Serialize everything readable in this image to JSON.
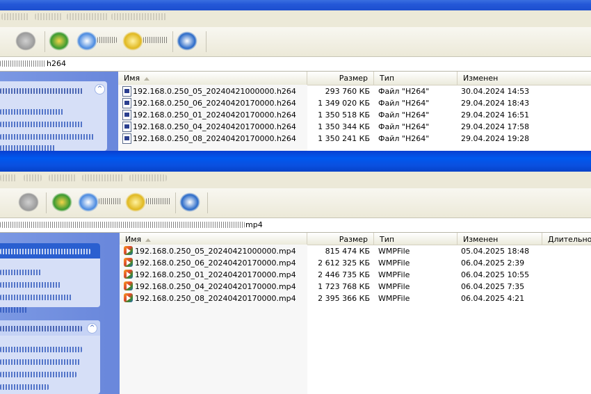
{
  "window1": {
    "address": {
      "value": "h264"
    },
    "columns": [
      {
        "label": "Имя"
      },
      {
        "label": "Размер"
      },
      {
        "label": "Тип"
      },
      {
        "label": "Изменен"
      }
    ],
    "files": [
      {
        "name": "192.168.0.250_05_20240421000000.h264",
        "size": "293 760 КБ",
        "type": "Файл \"H264\"",
        "modified": "30.04.2024 14:53"
      },
      {
        "name": "192.168.0.250_06_20240420170000.h264",
        "size": "1 349 020 КБ",
        "type": "Файл \"H264\"",
        "modified": "29.04.2024 18:43"
      },
      {
        "name": "192.168.0.250_01_20240420170000.h264",
        "size": "1 350 518 КБ",
        "type": "Файл \"H264\"",
        "modified": "29.04.2024 16:51"
      },
      {
        "name": "192.168.0.250_04_20240420170000.h264",
        "size": "1 350 344 КБ",
        "type": "Файл \"H264\"",
        "modified": "29.04.2024 17:58"
      },
      {
        "name": "192.168.0.250_08_20240420170000.h264",
        "size": "1 350 241 КБ",
        "type": "Файл \"H264\"",
        "modified": "29.04.2024 19:28"
      }
    ]
  },
  "window2": {
    "address": {
      "value": "mp4"
    },
    "columns": [
      {
        "label": "Имя"
      },
      {
        "label": "Размер"
      },
      {
        "label": "Тип"
      },
      {
        "label": "Изменен"
      },
      {
        "label": "Длительность"
      }
    ],
    "files": [
      {
        "name": "192.168.0.250_05_20240421000000.mp4",
        "size": "815 474 КБ",
        "type": "WMPFile",
        "modified": "05.04.2025 18:48"
      },
      {
        "name": "192.168.0.250_06_20240420170000.mp4",
        "size": "2 612 325 КБ",
        "type": "WMPFile",
        "modified": "06.04.2025 2:39"
      },
      {
        "name": "192.168.0.250_01_20240420170000.mp4",
        "size": "2 446 735 КБ",
        "type": "WMPFile",
        "modified": "06.04.2025 10:55"
      },
      {
        "name": "192.168.0.250_04_20240420170000.mp4",
        "size": "1 723 768 КБ",
        "type": "WMPFile",
        "modified": "06.04.2025 7:35"
      },
      {
        "name": "192.168.0.250_08_20240420170000.mp4",
        "size": "2 395 366 КБ",
        "type": "WMPFile",
        "modified": "06.04.2025 4:21"
      }
    ]
  },
  "icons": {
    "toolbar": [
      "back-icon",
      "forward-icon",
      "search-icon",
      "folders-icon",
      "views-icon"
    ],
    "h264_file": "h264-file-icon",
    "mp4_file": "wmp-file-icon",
    "taskpane_collapse": "chevron-up-icon"
  },
  "colors": {
    "titlebar": "#2458d8",
    "taskpane": "#7b98e3",
    "menubar": "#ece9d8"
  }
}
